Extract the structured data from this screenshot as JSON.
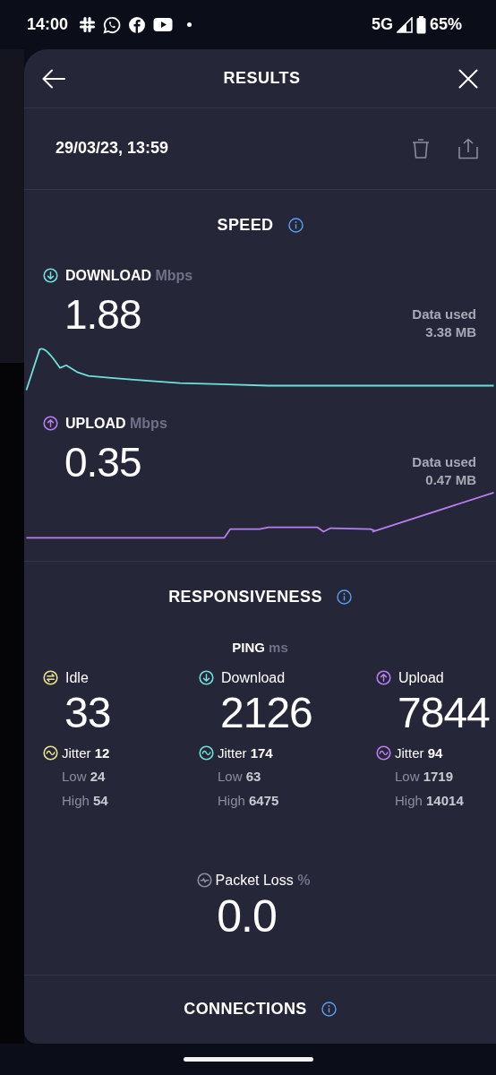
{
  "status_bar": {
    "time": "14:00",
    "network": "5G",
    "battery": "65%"
  },
  "header": {
    "title": "RESULTS"
  },
  "result": {
    "date": "29/03/23, 13:59"
  },
  "speed": {
    "title": "SPEED",
    "tests": [
      {
        "kind": "download",
        "label": "DOWNLOAD",
        "unit": "Mbps",
        "value": "1.88",
        "data_used_label": "Data used",
        "data_used": "3.38 MB",
        "color": "#6fe0d8"
      },
      {
        "kind": "upload",
        "label": "UPLOAD",
        "unit": "Mbps",
        "value": "0.35",
        "data_used_label": "Data used",
        "data_used": "0.47 MB",
        "color": "#b77ef0"
      }
    ]
  },
  "responsiveness": {
    "title": "RESPONSIVENESS",
    "ping_label": "PING",
    "ping_unit": "ms",
    "columns": [
      {
        "kind": "idle",
        "label": "Idle",
        "value": "33",
        "jitter_label": "Jitter",
        "jitter": "12",
        "low_label": "Low",
        "low": "24",
        "high_label": "High",
        "high": "54",
        "color": "#e9e28c"
      },
      {
        "kind": "download",
        "label": "Download",
        "value": "2126",
        "jitter_label": "Jitter",
        "jitter": "174",
        "low_label": "Low",
        "low": "63",
        "high_label": "High",
        "high": "6475",
        "color": "#6fe0d8"
      },
      {
        "kind": "upload",
        "label": "Upload",
        "value": "7844",
        "jitter_label": "Jitter",
        "jitter": "94",
        "low_label": "Low",
        "low": "1719",
        "high_label": "High",
        "high": "14014",
        "color": "#b77ef0"
      }
    ],
    "packet_loss": {
      "label": "Packet Loss",
      "unit": "%",
      "value": "0.0"
    }
  },
  "connections": {
    "title": "CONNECTIONS"
  }
}
